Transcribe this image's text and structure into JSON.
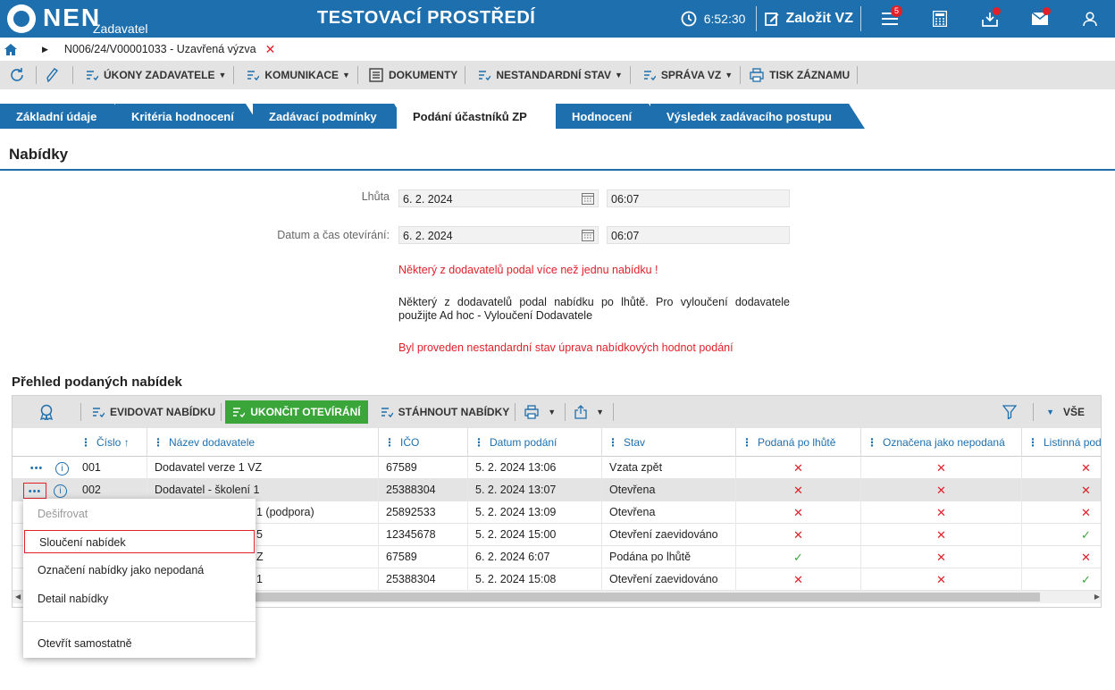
{
  "header": {
    "logo": "NEN",
    "logo_sub": "Zadavatel",
    "env_title": "TESTOVACÍ PROSTŘEDÍ",
    "time": "6:52:30",
    "create_label": "Založit VZ",
    "menu_badge": "5"
  },
  "breadcrumb": {
    "path": "N006/24/V00001033 - Uzavřená výzva"
  },
  "actions": {
    "ukony": "ÚKONY ZADAVATELE",
    "komunikace": "KOMUNIKACE",
    "dokumenty": "DOKUMENTY",
    "nestandardni": "NESTANDARDNÍ STAV",
    "sprava": "SPRÁVA VZ",
    "tisk": "TISK ZÁZNAMU"
  },
  "tabs": [
    {
      "label": "Základní údaje"
    },
    {
      "label": "Kritéria hodnocení"
    },
    {
      "label": "Zadávací podmínky"
    },
    {
      "label": "Podání účastníků ZP"
    },
    {
      "label": "Hodnocení"
    },
    {
      "label": "Výsledek zadávacího postupu"
    }
  ],
  "section_title": "Nabídky",
  "fields": {
    "lhuta_label": "Lhůta",
    "lhuta_date": "6. 2. 2024",
    "lhuta_time": "06:07",
    "otevirani_label": "Datum a čas otevírání:",
    "otevirani_date": "6. 2. 2024",
    "otevirani_time": "06:07"
  },
  "messages": {
    "multi_offer": "Některý z dodavatelů podal více než jednu nabídku !",
    "late_offer": "Některý z dodavatelů podal nabídku po lhůtě. Pro vyloučení dodavatele použijte Ad hoc - Vyloučení Dodavatele",
    "nonstandard": "Byl proveden nestandardní stav úprava nabídkových hodnot podání"
  },
  "grid": {
    "title": "Přehled podaných nabídek",
    "toolbar": {
      "evidovat": "EVIDOVAT NABÍDKU",
      "ukoncit": "UKONČIT OTEVÍRÁNÍ",
      "stahnout": "STÁHNOUT NABÍDKY",
      "filter_all": "VŠE"
    },
    "columns": {
      "cislo": "Číslo",
      "nazev": "Název dodavatele",
      "ico": "IČO",
      "datum": "Datum podání",
      "stav": "Stav",
      "po_lhute": "Podaná po lhůtě",
      "nepodana": "Označena jako nepodaná",
      "listinna": "Listinná pod"
    },
    "rows": [
      {
        "cislo": "001",
        "nazev": "Dodavatel verze 1 VZ",
        "ico": "67589",
        "datum": "5. 2. 2024 13:06",
        "stav": "Vzata zpět",
        "po_lhute": "✕",
        "nepodana": "✕",
        "listinna": "✕"
      },
      {
        "cislo": "002",
        "nazev": "Dodavatel - školení 1",
        "ico": "25388304",
        "datum": "5. 2. 2024 13:07",
        "stav": "Otevřena",
        "po_lhute": "✕",
        "nepodana": "✕",
        "listinna": "✕"
      },
      {
        "cislo": "",
        "nazev": "1 (podpora)",
        "ico": "25892533",
        "datum": "5. 2. 2024 13:09",
        "stav": "Otevřena",
        "po_lhute": "✕",
        "nepodana": "✕",
        "listinna": "✕"
      },
      {
        "cislo": "",
        "nazev": "5",
        "ico": "12345678",
        "datum": "5. 2. 2024 15:00",
        "stav": "Otevření zaevidováno",
        "po_lhute": "✕",
        "nepodana": "✕",
        "listinna": "✓"
      },
      {
        "cislo": "",
        "nazev": "Z",
        "ico": "67589",
        "datum": "6. 2. 2024 6:07",
        "stav": "Podána po lhůtě",
        "po_lhute": "✓",
        "nepodana": "✕",
        "listinna": "✕"
      },
      {
        "cislo": "",
        "nazev": "1",
        "ico": "25388304",
        "datum": "5. 2. 2024 15:08",
        "stav": "Otevření zaevidováno",
        "po_lhute": "✕",
        "nepodana": "✕",
        "listinna": "✓"
      }
    ]
  },
  "context_menu": {
    "desifrovat": "Dešifrovat",
    "slouceni": "Sloučení nabídek",
    "oznaceni": "Označení nabídky jako nepodaná",
    "detail": "Detail nabídky",
    "otevrit": "Otevřít samostatně"
  },
  "colors": {
    "brand": "#1d6fae",
    "danger": "#e0212a",
    "success": "#3aa63a"
  }
}
